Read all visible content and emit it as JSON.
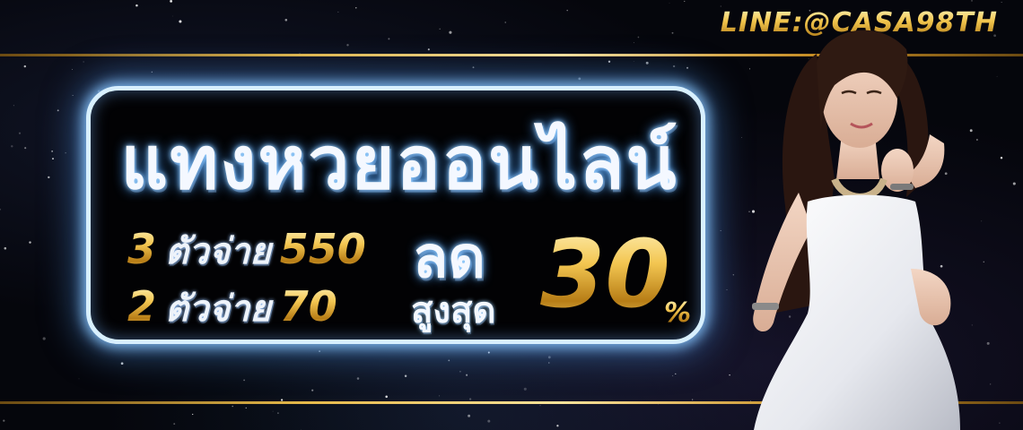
{
  "contact": {
    "line_id": "LINE:@CASA98TH"
  },
  "headline": "แทงหวยออนไลน์",
  "payouts": [
    {
      "digits": "3",
      "label": "ตัวจ่าย",
      "rate": "550"
    },
    {
      "digits": "2",
      "label": "ตัวจ่าย",
      "rate": "70"
    }
  ],
  "discount": {
    "word": "ลด",
    "max_word": "สูงสุด",
    "value": "30",
    "unit": "%"
  },
  "colors": {
    "gold": "#f3c651",
    "glow": "#9fd4ff",
    "background": "#05060c"
  },
  "icons": {
    "model": "woman-in-white-dress-photo"
  }
}
